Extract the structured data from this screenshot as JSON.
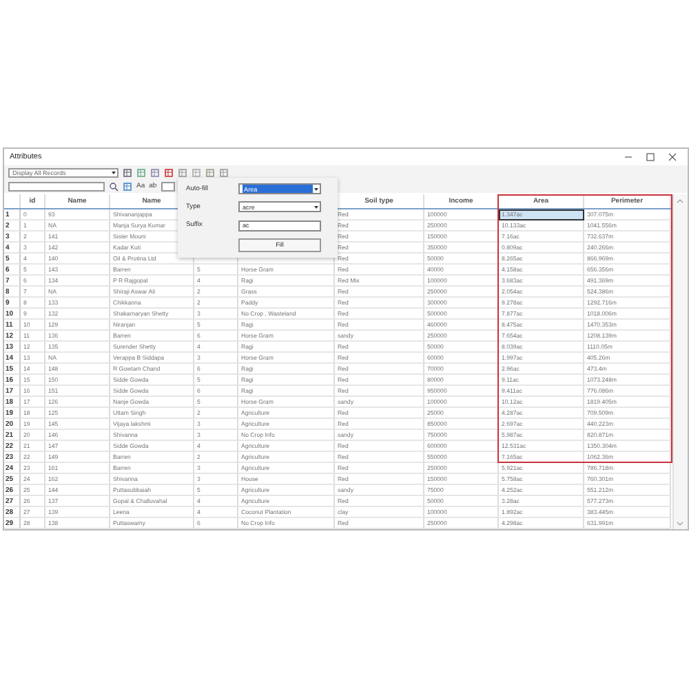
{
  "window": {
    "title": "Attributes"
  },
  "toolbar": {
    "records_dropdown": "Display All Records",
    "case_buttons": [
      "Aa",
      "ab"
    ]
  },
  "autofill": {
    "label": "Auto-fill",
    "field": "Area",
    "field_selected": true,
    "type_label": "Type",
    "type": "acre",
    "suffix_label": "Suffix",
    "suffix": "ac",
    "button": "Fill"
  },
  "table": {
    "columns": [
      "id",
      "Name",
      "Name",
      null,
      null,
      "Soil type",
      "Income",
      "Area",
      "Perimeter"
    ],
    "rows": [
      {
        "n": "1",
        "cells": [
          "0",
          "93",
          "Shivananjappa",
          null,
          null,
          "Red",
          "100000",
          "1.347ac",
          "307.075m"
        ],
        "selected": true
      },
      {
        "n": "2",
        "cells": [
          "1",
          "NA",
          "Manja Surya Kumar",
          null,
          null,
          "Red",
          "250000",
          "10.133ac",
          "1041.556m"
        ],
        "selected": false
      },
      {
        "n": "3",
        "cells": [
          "2",
          "141",
          "Sister Mouni",
          null,
          null,
          "Red",
          "150000",
          "7.16ac",
          "732.637m"
        ],
        "selected": false
      },
      {
        "n": "4",
        "cells": [
          "3",
          "142",
          "Kadar Kuti",
          null,
          null,
          "Red",
          "350000",
          "0.809ac",
          "240.266m"
        ],
        "selected": false
      },
      {
        "n": "5",
        "cells": [
          "4",
          "140",
          "Oil & Protina Ltd",
          null,
          null,
          "Red",
          "50000",
          "8.265ac",
          "866.969m"
        ],
        "selected": false
      },
      {
        "n": "6",
        "cells": [
          "5",
          "143",
          "Barren",
          "5",
          "Horse Gram",
          "Red",
          "40000",
          "4.158ac",
          "656.356m"
        ],
        "selected": false
      },
      {
        "n": "7",
        "cells": [
          "6",
          "134",
          "P R Rajgopal",
          "4",
          "Ragi",
          "Red Mix",
          "100000",
          "3.683ac",
          "491.369m"
        ],
        "selected": false
      },
      {
        "n": "8",
        "cells": [
          "7",
          "NA",
          "Shiraji Aswar Ali",
          "2",
          "Grass",
          "Red",
          "250000",
          "2.054ac",
          "524.386m"
        ],
        "selected": false
      },
      {
        "n": "9",
        "cells": [
          "8",
          "133",
          "Chikkanna",
          "2",
          "Paddy",
          "Red",
          "300000",
          "9.278ac",
          "1292.716m"
        ],
        "selected": false
      },
      {
        "n": "10",
        "cells": [
          "9",
          "132",
          "Shakarnaryan Shetty",
          "3",
          "No Crop , Wasteland",
          "Red",
          "500000",
          "7.877ac",
          "1018.006m"
        ],
        "selected": false
      },
      {
        "n": "11",
        "cells": [
          "10",
          "129",
          "Niranjan",
          "5",
          "Ragi",
          "Red",
          "460000",
          "8.475ac",
          "1470.353m"
        ],
        "selected": false
      },
      {
        "n": "12",
        "cells": [
          "11",
          "136",
          "Barren",
          "6",
          "Horse Gram",
          "sandy",
          "250000",
          "7.654ac",
          "1208.139m"
        ],
        "selected": false
      },
      {
        "n": "13",
        "cells": [
          "12",
          "135",
          "Surender Shetty",
          "4",
          "Ragi",
          "Red",
          "50000",
          "8.039ac",
          "1110.05m"
        ],
        "selected": false
      },
      {
        "n": "14",
        "cells": [
          "13",
          "NA",
          "Verappa B Siddapa",
          "3",
          "Horse Gram",
          "Red",
          "60000",
          "1.997ac",
          "405.26m"
        ],
        "selected": false
      },
      {
        "n": "15",
        "cells": [
          "14",
          "148",
          "R Gowtam Chand",
          "6",
          "Ragi",
          "Red",
          "70000",
          "2.96ac",
          "473.4m"
        ],
        "selected": false
      },
      {
        "n": "16",
        "cells": [
          "15",
          "150",
          "Sidde Gowda",
          "5",
          "Ragi",
          "Red",
          "80000",
          "9.11ac",
          "1073.248m"
        ],
        "selected": false
      },
      {
        "n": "17",
        "cells": [
          "16",
          "151",
          "Sidde Gowda",
          "6",
          "Ragi",
          "Red",
          "950000",
          "9.411ac",
          "776.086m"
        ],
        "selected": false
      },
      {
        "n": "18",
        "cells": [
          "17",
          "126",
          "Nanje Gowda",
          "5",
          "Horse Gram",
          "sandy",
          "100000",
          "10.12ac",
          "1819.405m"
        ],
        "selected": false
      },
      {
        "n": "19",
        "cells": [
          "18",
          "125",
          "Uttam Singh",
          "2",
          "Agriculture",
          "Red",
          "25000",
          "4.287ac",
          "709.509m"
        ],
        "selected": false
      },
      {
        "n": "20",
        "cells": [
          "19",
          "145",
          "Vijaya lakshmi",
          "3",
          "Agriculture",
          "Red",
          "850000",
          "2.697ac",
          "440.223m"
        ],
        "selected": false
      },
      {
        "n": "21",
        "cells": [
          "20",
          "146",
          "Shivanna",
          "3",
          "No Crop Info",
          "sandy",
          "750000",
          "5.987ac",
          "820.871m"
        ],
        "selected": false
      },
      {
        "n": "22",
        "cells": [
          "21",
          "147",
          "Sidde Gowda",
          "4",
          "Agriculture",
          "Red",
          "600000",
          "12.531ac",
          "1350.304m"
        ],
        "selected": false
      },
      {
        "n": "23",
        "cells": [
          "22",
          "149",
          "Barren",
          "2",
          "Agriculture",
          "Red",
          "550000",
          "7.165ac",
          "1062.36m"
        ],
        "selected": false
      },
      {
        "n": "24",
        "cells": [
          "23",
          "161",
          "Barren",
          "3",
          "Agriculture",
          "Red",
          "250000",
          "5.921ac",
          "786.718m"
        ],
        "selected": false
      },
      {
        "n": "25",
        "cells": [
          "24",
          "162",
          "Shivanna",
          "3",
          "House",
          "Red",
          "150000",
          "5.758ac",
          "760.301m"
        ],
        "selected": false
      },
      {
        "n": "26",
        "cells": [
          "25",
          "144",
          "Puttasubbaiah",
          "5",
          "Agriculture",
          "sandy",
          "75000",
          "4.252ac",
          "551.212m"
        ],
        "selected": false
      },
      {
        "n": "27",
        "cells": [
          "26",
          "137",
          "Gopal & Challuvahal",
          "4",
          "Agriculture",
          "Red",
          "50000",
          "3.28ac",
          "577.273m"
        ],
        "selected": false
      },
      {
        "n": "28",
        "cells": [
          "27",
          "139",
          "Leena",
          "4",
          "Coconut Plantation",
          "clay",
          "100000",
          "1.892ac",
          "383.445m"
        ],
        "selected": false
      },
      {
        "n": "29",
        "cells": [
          "28",
          "138",
          "Puttaswamy",
          "6",
          "No Crop Info",
          "Red",
          "250000",
          "4.298ac",
          "631.991m"
        ],
        "selected": false
      }
    ]
  }
}
